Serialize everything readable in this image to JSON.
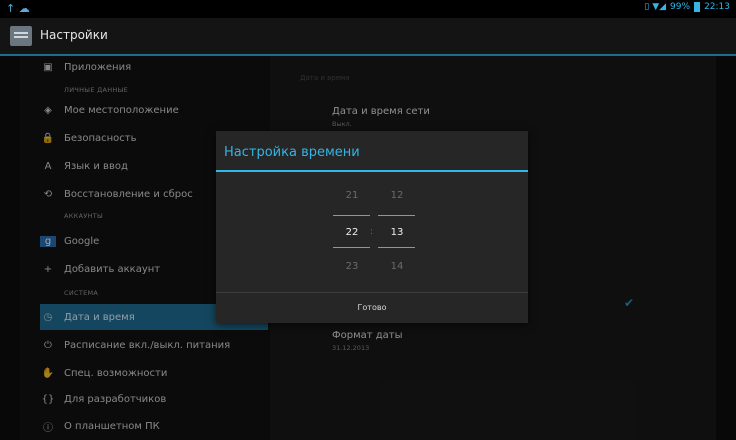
{
  "status": {
    "percent": "99%",
    "time": "22:13",
    "left_icons": "↑ ☁",
    "right_icons": "▯ ▼◢"
  },
  "actionbar": {
    "title": "Настройки"
  },
  "sidebar": {
    "items": [
      {
        "label": "Приложения",
        "icon": "▣"
      },
      {
        "label": "Мое местоположение",
        "icon": "◈"
      },
      {
        "label": "Безопасность",
        "icon": "🔒"
      },
      {
        "label": "Язык и ввод",
        "icon": "A"
      },
      {
        "label": "Восстановление и сброс",
        "icon": "⟲"
      },
      {
        "label": "Google",
        "icon": "g"
      },
      {
        "label": "Добавить аккаунт",
        "icon": "+"
      },
      {
        "label": "Дата и время",
        "icon": "◷"
      },
      {
        "label": "Расписание вкл./выкл. питания",
        "icon": "⏻"
      },
      {
        "label": "Спец. возможности",
        "icon": "✋"
      },
      {
        "label": "Для разработчиков",
        "icon": "{}"
      },
      {
        "label": "О планшетном ПК",
        "icon": "ⓘ"
      }
    ],
    "sections": [
      "ЛИЧНЫЕ ДАННЫЕ",
      "АККАУНТЫ",
      "СИСТЕМА"
    ]
  },
  "detail": {
    "header": "Дата и время",
    "network_time_label": "Дата и время сети",
    "network_time_value": "Выкл.",
    "date_format_label": "Формат даты",
    "date_format_value": "31.12.2013",
    "check_icon": "✔"
  },
  "dialog": {
    "title": "Настройка времени",
    "hours": [
      "21",
      "22",
      "23"
    ],
    "minutes": [
      "12",
      "13",
      "14"
    ],
    "separator": ":",
    "done_label": "Готово"
  }
}
